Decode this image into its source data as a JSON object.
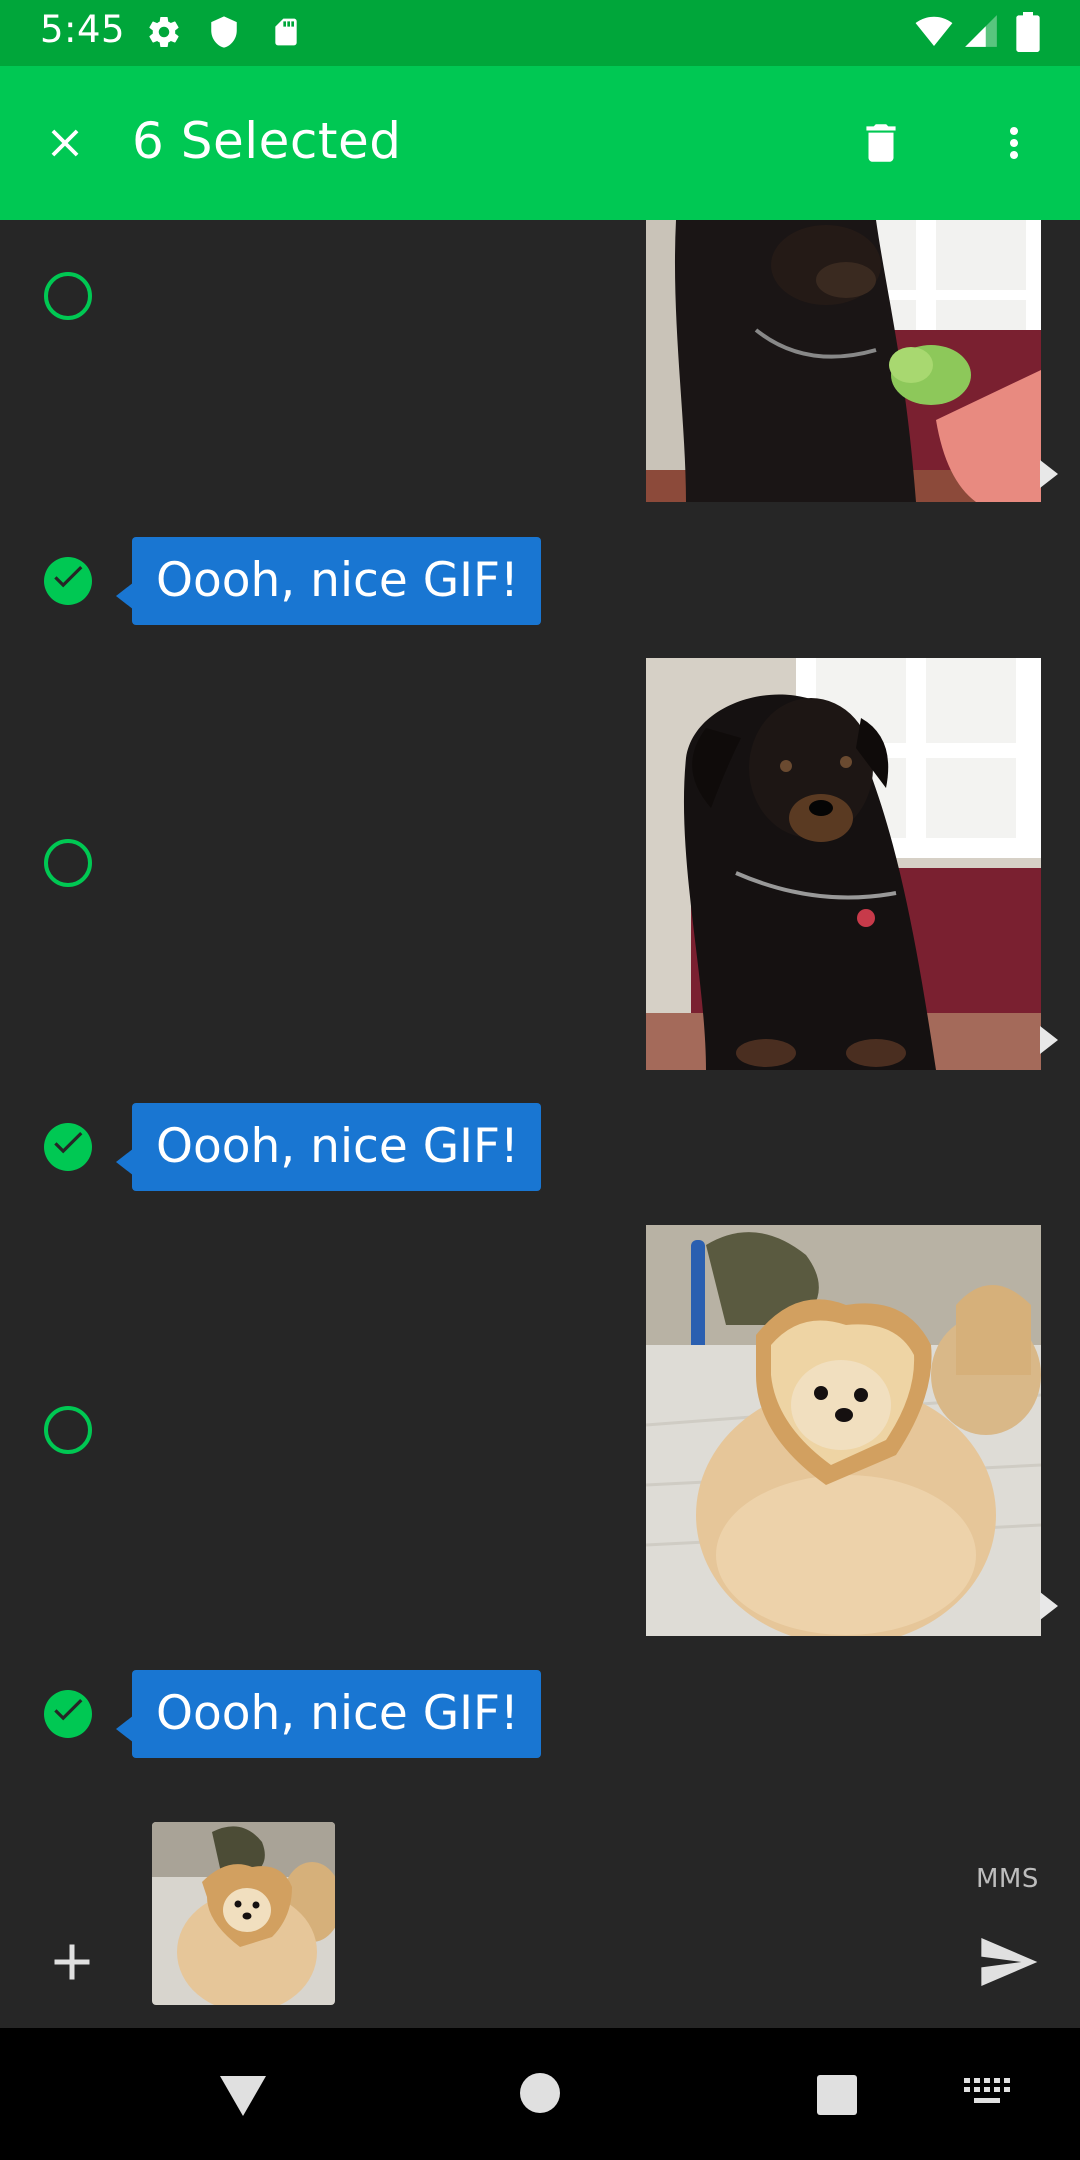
{
  "status_bar": {
    "time": "5:45",
    "icons_left": [
      "gear-icon",
      "shield-icon",
      "sd-card-icon"
    ],
    "icons_right": [
      "wifi-icon",
      "signal-icon",
      "battery-icon"
    ]
  },
  "app_bar": {
    "title": "6 Selected",
    "close_icon": "close-icon",
    "delete_icon": "trash-icon",
    "overflow_icon": "more-vert-icon",
    "background": "#00C853"
  },
  "messages": [
    {
      "type": "gif",
      "content": "rottweiler-eating-gif",
      "selected": false
    },
    {
      "type": "text",
      "text": "Oooh, nice GIF!",
      "selected": true
    },
    {
      "type": "gif",
      "content": "rottweiler-sitting-gif",
      "selected": false
    },
    {
      "type": "text",
      "text": "Oooh, nice GIF!",
      "selected": true
    },
    {
      "type": "gif",
      "content": "pomeranian-bread-gif",
      "selected": false
    },
    {
      "type": "text",
      "text": "Oooh, nice GIF!",
      "selected": true
    }
  ],
  "compose": {
    "add_icon": "plus-icon",
    "attachment": "pomeranian-bread-thumbnail",
    "mode_label": "MMS",
    "send_icon": "send-icon"
  },
  "nav_bar": {
    "buttons": [
      "back-icon",
      "home-icon",
      "recents-icon",
      "keyboard-icon"
    ]
  },
  "colors": {
    "accent": "#00C853",
    "status_bar": "#00A63A",
    "bubble": "#1976D2",
    "background": "#262626"
  }
}
